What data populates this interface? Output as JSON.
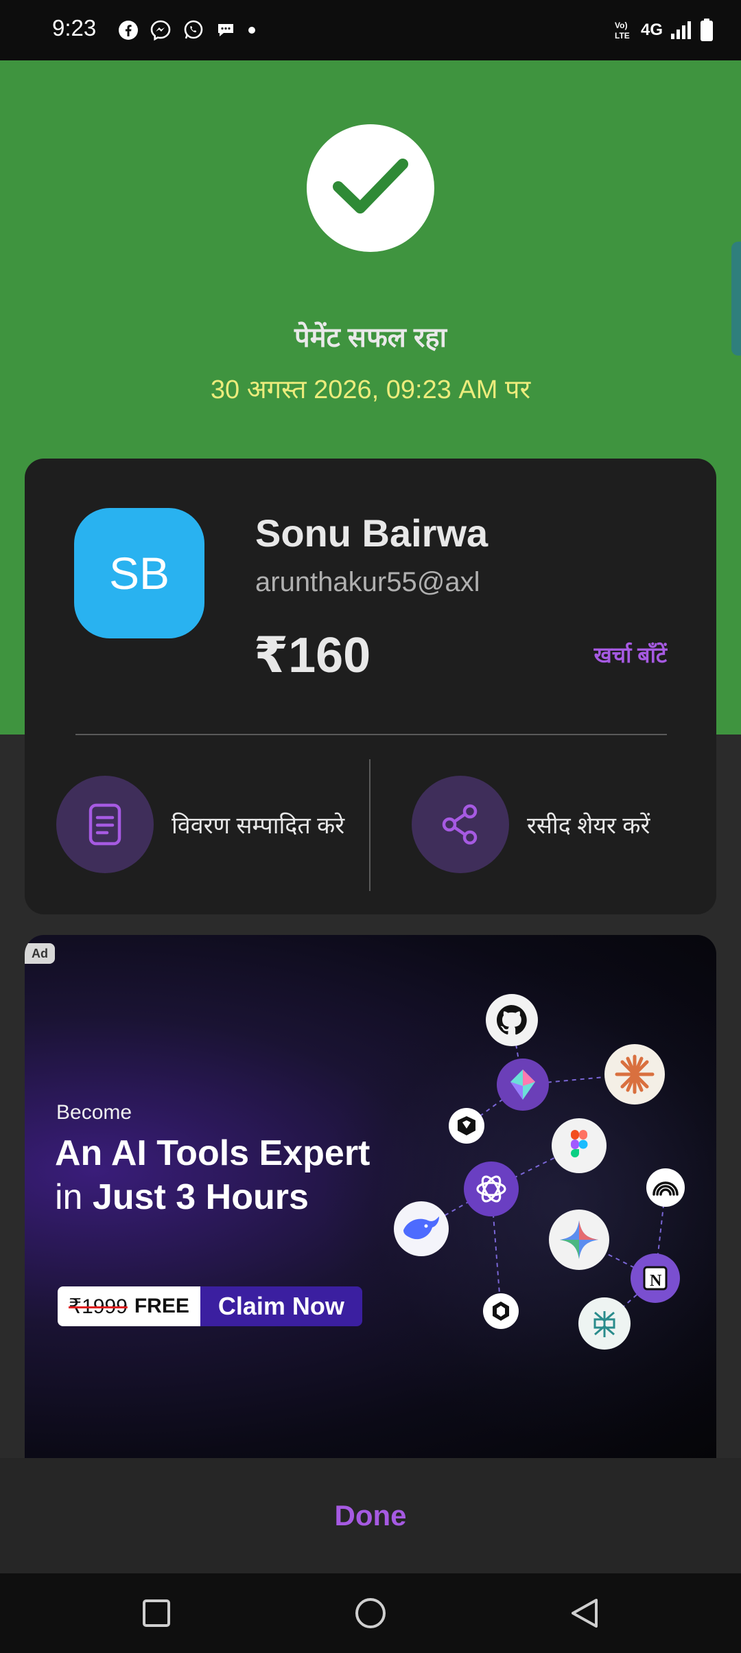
{
  "status_bar": {
    "time": "9:23",
    "left_icons": [
      "facebook-icon",
      "messenger-icon",
      "whatsapp-icon",
      "chat-bubble-icon",
      "dot-icon"
    ],
    "right_icons": [
      "volte-icon",
      "4g-signal-icon",
      "battery-icon"
    ],
    "network_label": "4G",
    "volte_label": "Vo) LTE"
  },
  "header": {
    "title": "पेमेंट सफल रहा",
    "datetime": "30 अगस्त 2026, 09:23 AM पर",
    "background": "#3f943f"
  },
  "payee": {
    "initials": "SB",
    "name": "Sonu Bairwa",
    "upi_id": "arunthakur55@axl",
    "amount": "₹160",
    "split_label": "खर्चा बाँटें",
    "avatar_color": "#29b2f0"
  },
  "actions": [
    {
      "label": "विवरण सम्पादित करे",
      "icon": "document-edit-icon"
    },
    {
      "label": "रसीद शेयर करें",
      "icon": "share-icon"
    }
  ],
  "ad": {
    "badge": "Ad",
    "become": "Become",
    "headline_line1": "An AI Tools Expert",
    "headline_line2_prefix": "in ",
    "headline_line2_bold": "Just 3 Hours",
    "old_price": "₹1999",
    "free_label": "FREE",
    "cta_label": "Claim Now",
    "tool_icons": [
      "github-icon",
      "gemini-diamond-icon",
      "claude-icon",
      "perplexity-cube-icon",
      "figma-icon",
      "openai-icon",
      "wireless-icon",
      "deepseek-icon",
      "gemini-star-icon",
      "notion-icon",
      "cube-icon",
      "perplexity-icon"
    ]
  },
  "footer": {
    "done_label": "Done"
  },
  "accent_color": "#a65ae2"
}
